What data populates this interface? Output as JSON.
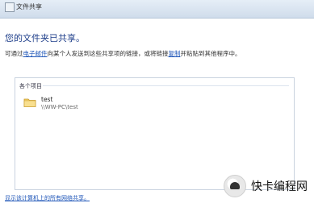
{
  "window": {
    "title": "文件共享",
    "icon": "share-icon"
  },
  "main": {
    "heading": "您的文件夹已共享。",
    "description_before_link1": "可通过",
    "link1": "电子邮件",
    "description_middle": "向某个人发送到这些共享项的链接，或将链接",
    "link2": "复制",
    "description_after": "并粘贴到其他程序中。"
  },
  "items": {
    "group_title": "各个项目",
    "list": [
      {
        "name": "test",
        "path": "\\\\WW-PC\\test",
        "icon": "folder-icon"
      }
    ]
  },
  "footer": {
    "network_link": "显示该计算机上的所有网络共享。"
  },
  "watermark": {
    "text": "快卡编程网"
  }
}
